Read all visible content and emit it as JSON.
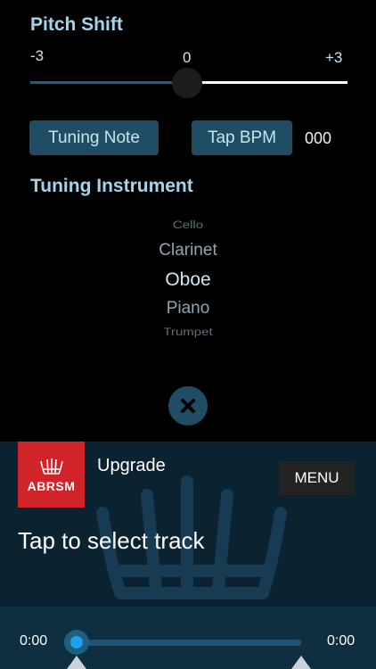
{
  "pitch_shift": {
    "title": "Pitch Shift",
    "min_label": "-3",
    "mid_label": "0",
    "max_label": "+3",
    "value": 0
  },
  "controls": {
    "tuning_note_label": "Tuning Note",
    "tap_bpm_label": "Tap BPM",
    "bpm_value": "000"
  },
  "tuning_instrument": {
    "title": "Tuning Instrument",
    "items": [
      "Cello",
      "Clarinet",
      "Oboe",
      "Piano",
      "Trumpet"
    ],
    "selected": "Oboe"
  },
  "close_icon": "close-icon",
  "footer": {
    "logo_text": "ABRSM",
    "upgrade_label": "Upgrade",
    "menu_label": "MENU",
    "prompt": "Tap to select track",
    "time_start": "0:00",
    "time_end": "0:00",
    "progress": 0
  },
  "colors": {
    "accent": "#a7d3ea",
    "button_bg": "#1f4d63",
    "logo_red": "#d1232a",
    "footer_bg": "#0b2230",
    "progress_blue": "#1aa3e8"
  }
}
